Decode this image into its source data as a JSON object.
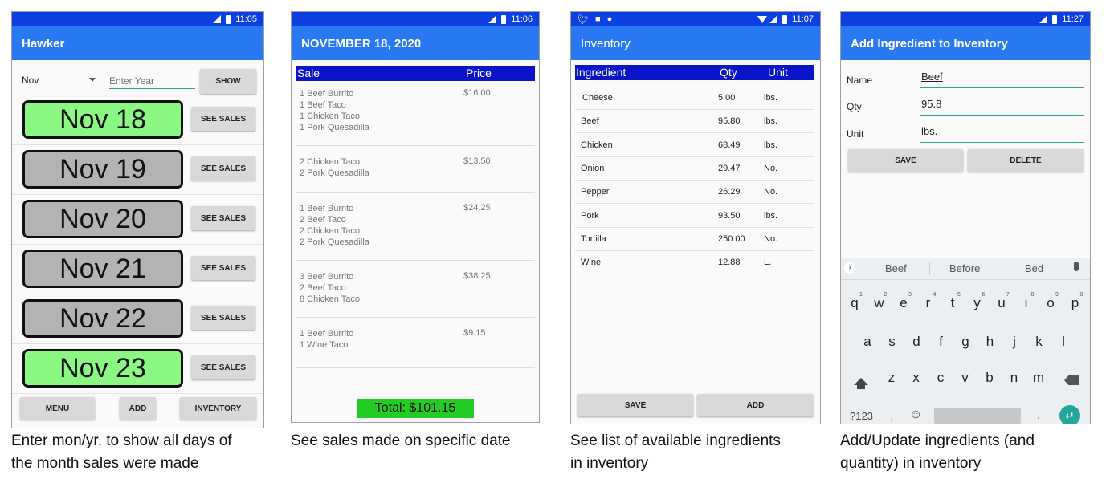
{
  "colors": {
    "status": "#0c40e0",
    "appbar": "#2979f2",
    "green_day": "#8af882",
    "gray_day": "#b3b3b3",
    "table_header": "#0a14c8",
    "total_bg": "#22cc22",
    "accent": "#26a69a"
  },
  "screen1": {
    "time": "11:05",
    "title": "Hawker",
    "month_value": "Nov",
    "year_placeholder": "Enter Year",
    "show_label": "SHOW",
    "days": [
      {
        "label": "Nov 18",
        "has_sales": true,
        "btn": "SEE SALES"
      },
      {
        "label": "Nov 19",
        "has_sales": false,
        "btn": "SEE SALES"
      },
      {
        "label": "Nov 20",
        "has_sales": false,
        "btn": "SEE SALES"
      },
      {
        "label": "Nov 21",
        "has_sales": false,
        "btn": "SEE SALES"
      },
      {
        "label": "Nov 22",
        "has_sales": false,
        "btn": "SEE SALES"
      },
      {
        "label": "Nov 23",
        "has_sales": true,
        "btn": "SEE SALES"
      }
    ],
    "menu_label": "MENU",
    "add_label": "ADD",
    "inventory_label": "INVENTORY",
    "caption_line1": "Enter mon/yr. to show all days of",
    "caption_line2": "the month sales were made"
  },
  "screen2": {
    "time": "11:06",
    "title": "NOVEMBER 18, 2020",
    "col_sale": "Sale",
    "col_price": "Price",
    "sales": [
      {
        "items": [
          "1 Beef Burrito",
          "1 Beef Taco",
          "1 Chicken Taco",
          "1 Pork Quesadilla"
        ],
        "price": "$16.00"
      },
      {
        "items": [
          "2 Chicken Taco",
          "2 Pork Quesadilla"
        ],
        "price": "$13.50"
      },
      {
        "items": [
          "1 Beef Burrito",
          "2 Beef Taco",
          "2 Chicken Taco",
          "2 Pork Quesadilla"
        ],
        "price": "$24.25"
      },
      {
        "items": [
          "3 Beef Burrito",
          "2 Beef Taco",
          "8 Chicken Taco"
        ],
        "price": "$38.25"
      },
      {
        "items": [
          "1 Beef Burrito",
          "1 Wine Taco"
        ],
        "price": "$9.15"
      }
    ],
    "total": "Total: $101.15",
    "caption": "See sales made on specific date"
  },
  "screen3": {
    "time": "11:07",
    "title": "Inventory",
    "col_ingredient": "Ingredient",
    "col_qty": "Qty",
    "col_unit": "Unit",
    "rows": [
      {
        "name": "Cheese",
        "qty": "5.00",
        "unit": "lbs."
      },
      {
        "name": "Beef",
        "qty": "95.80",
        "unit": "lbs."
      },
      {
        "name": "Chicken",
        "qty": "68.49",
        "unit": "lbs."
      },
      {
        "name": "Onion",
        "qty": "29.47",
        "unit": "No."
      },
      {
        "name": "Pepper",
        "qty": "26.29",
        "unit": "No."
      },
      {
        "name": "Pork",
        "qty": "93.50",
        "unit": "lbs."
      },
      {
        "name": "Tortilla",
        "qty": "250.00",
        "unit": "No."
      },
      {
        "name": "Wine",
        "qty": "12.88",
        "unit": "L."
      }
    ],
    "save_label": "SAVE",
    "add_label": "ADD",
    "caption_line1": "See list of available ingredients",
    "caption_line2": "in inventory"
  },
  "screen4": {
    "time": "11:27",
    "title": "Add Ingredient to Inventory",
    "name_label": "Name",
    "name_value": "Beef",
    "qty_label": "Qty",
    "qty_value": "95.8",
    "unit_label": "Unit",
    "unit_value": "lbs.",
    "save_label": "SAVE",
    "delete_label": "DELETE",
    "suggestions": [
      "Beef",
      "Before",
      "Bed"
    ],
    "row1": [
      "q",
      "w",
      "e",
      "r",
      "t",
      "y",
      "u",
      "i",
      "o",
      "p"
    ],
    "row1_nums": [
      "1",
      "2",
      "3",
      "4",
      "5",
      "6",
      "7",
      "8",
      "9",
      "0"
    ],
    "row2": [
      "a",
      "s",
      "d",
      "f",
      "g",
      "h",
      "j",
      "k",
      "l"
    ],
    "row3": [
      "z",
      "x",
      "c",
      "v",
      "b",
      "n",
      "m"
    ],
    "sym_label": "?123",
    "comma": ",",
    "period": ".",
    "caption_line1": "Add/Update ingredients (and",
    "caption_line2": "quantity) in inventory"
  }
}
